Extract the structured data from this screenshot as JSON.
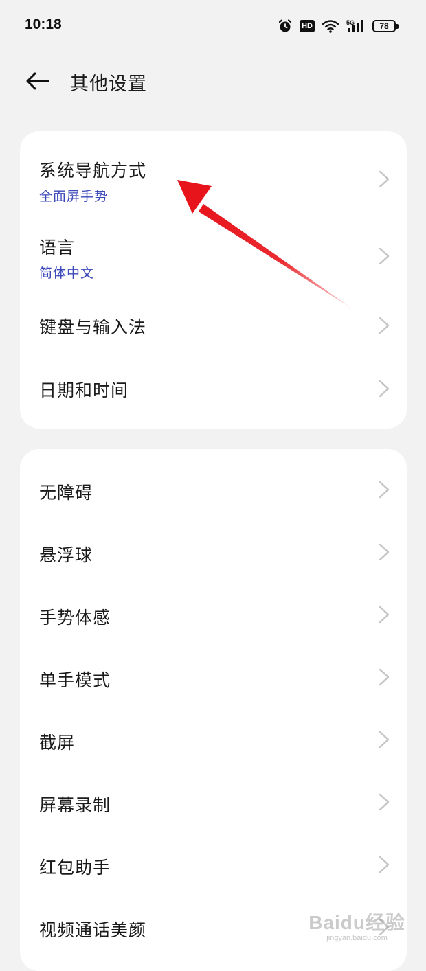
{
  "status_bar": {
    "time": "10:18",
    "battery": "78",
    "hd": "HD",
    "signal": "5G",
    "icons": [
      "alarm-icon",
      "hd-icon",
      "wifi-icon",
      "signal-5g-icon",
      "battery-icon"
    ]
  },
  "header": {
    "title": "其他设置",
    "back_icon": "arrow-left-icon"
  },
  "group_1": [
    {
      "title": "系统导航方式",
      "subtitle": "全面屏手势"
    },
    {
      "title": "语言",
      "subtitle": "简体中文"
    },
    {
      "title": "键盘与输入法"
    },
    {
      "title": "日期和时间"
    }
  ],
  "group_2": [
    {
      "title": "无障碍"
    },
    {
      "title": "悬浮球"
    },
    {
      "title": "手势体感"
    },
    {
      "title": "单手模式"
    },
    {
      "title": "截屏"
    },
    {
      "title": "屏幕录制"
    },
    {
      "title": "红包助手"
    },
    {
      "title": "视频通话美颜"
    }
  ],
  "colors": {
    "background": "#f2f2f2",
    "card": "#ffffff",
    "subtitle": "#3b48b9",
    "chevron": "#c4c4c4",
    "annotation_arrow": "#e8141b"
  },
  "watermark": {
    "logo": "Baidu经验",
    "sub": "jingyan.baidu.com"
  }
}
